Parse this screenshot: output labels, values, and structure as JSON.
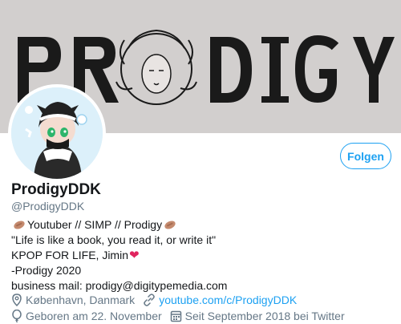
{
  "banner": {
    "title_text": "PRODIGY"
  },
  "profile": {
    "display_name": "ProdigyDDK",
    "handle": "@ProdigyDDK",
    "follow_label": "Folgen"
  },
  "bio": {
    "line1": "Youtuber // SIMP // Prodigy",
    "line2": "\"Life is like a book, you read it, or write it\"",
    "line3": "KPOP FOR LIFE, Jimin",
    "line4": "-Prodigy 2020",
    "line5": "business mail: prodigy@digitypemedia.com"
  },
  "meta": {
    "location": "København, Danmark",
    "website": "youtube.com/c/ProdigyDDK",
    "birthday": "Geboren am 22. November",
    "joined": "Seit September 2018 bei Twitter"
  },
  "colors": {
    "accent": "#1da1f2",
    "secondary_text": "#657786",
    "banner_bg": "#d2cfce",
    "heart": "#e0245e"
  },
  "icons": [
    "location-pin-icon",
    "link-icon",
    "balloon-icon",
    "calendar-icon",
    "peanut-emoji-icon",
    "heart-emoji-icon"
  ]
}
